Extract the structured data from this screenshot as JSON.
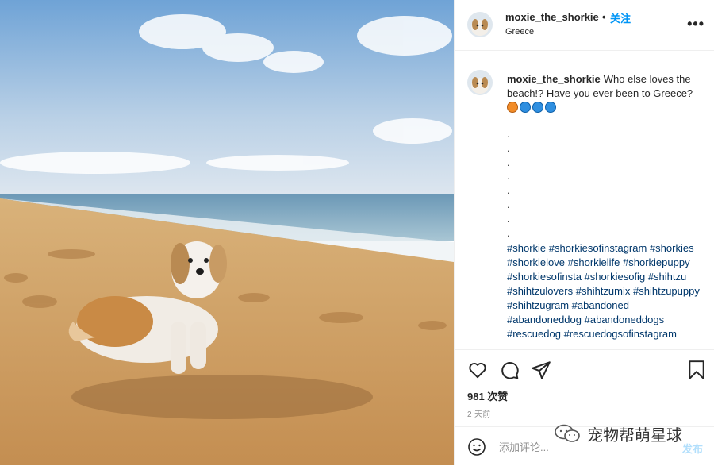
{
  "post": {
    "username": "moxie_the_shorkie",
    "separator": "•",
    "follow_label": "关注",
    "location": "Greece",
    "more_label": "•••",
    "caption_text": "Who else loves the beach!? Have you ever been to Greece?",
    "caption_emojis": [
      "fox-face",
      "wave",
      "wave",
      "wave"
    ],
    "dots": [
      ".",
      ".",
      ".",
      ".",
      ".",
      ".",
      ".",
      "."
    ],
    "hashtags": [
      "#shorkie",
      "#shorkiesofinstagram",
      "#shorkies",
      "#shorkielove",
      "#shorkielife",
      "#shorkiepuppy",
      "#shorkiesofinsta",
      "#shorkiesofig",
      "#shihtzu",
      "#shihtzulovers",
      "#shihtzumix",
      "#shihtzupuppy",
      "#shihtzugram",
      "#abandoned",
      "#abandoneddog",
      "#abandoneddogs",
      "#rescuedog",
      "#rescuedogsofinstagram"
    ],
    "likes": "981 次赞",
    "timestamp": "2 天前"
  },
  "comment_box": {
    "placeholder": "添加评论...",
    "post_label": "发布"
  },
  "icons": {
    "like": "heart-icon",
    "comment": "comment-icon",
    "share": "share-icon",
    "save": "bookmark-icon",
    "emoji": "emoji-icon"
  },
  "watermark": {
    "text": "宠物帮萌星球"
  },
  "colors": {
    "link": "#0095f6",
    "hashtag": "#00376b",
    "post_disabled": "#b2dffc"
  }
}
